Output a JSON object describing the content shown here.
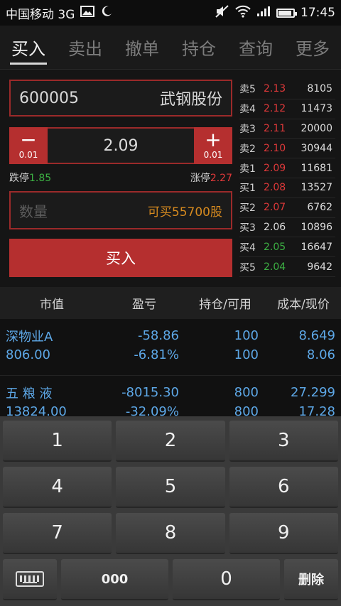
{
  "statusbar": {
    "carrier": "中国移动 3G",
    "time": "17:45",
    "battery_level": 0.9
  },
  "tabs": [
    {
      "label": "买入"
    },
    {
      "label": "卖出"
    },
    {
      "label": "撤单"
    },
    {
      "label": "持仓"
    },
    {
      "label": "查询"
    },
    {
      "label": "更多"
    }
  ],
  "order": {
    "stock_code": "600005",
    "stock_name": "武钢股份",
    "minus_symbol": "−",
    "plus_symbol": "+",
    "step": "0.01",
    "price": "2.09",
    "limit_down_label": "跌停",
    "limit_down": "1.85",
    "limit_up_label": "涨停",
    "limit_up": "2.27",
    "qty_placeholder": "数量",
    "available": "可买55700股",
    "buy_label": "买入"
  },
  "book": [
    {
      "label": "卖5",
      "price": "2.13",
      "volume": "8105",
      "color": "red"
    },
    {
      "label": "卖4",
      "price": "2.12",
      "volume": "11473",
      "color": "red"
    },
    {
      "label": "卖3",
      "price": "2.11",
      "volume": "20000",
      "color": "red"
    },
    {
      "label": "卖2",
      "price": "2.10",
      "volume": "30944",
      "color": "red"
    },
    {
      "label": "卖1",
      "price": "2.09",
      "volume": "11681",
      "color": "red"
    },
    {
      "label": "买1",
      "price": "2.08",
      "volume": "13527",
      "color": "red"
    },
    {
      "label": "买2",
      "price": "2.07",
      "volume": "6762",
      "color": "red"
    },
    {
      "label": "买3",
      "price": "2.06",
      "volume": "10896",
      "color": "white"
    },
    {
      "label": "买4",
      "price": "2.05",
      "volume": "16647",
      "color": "green"
    },
    {
      "label": "买5",
      "price": "2.04",
      "volume": "9642",
      "color": "green"
    }
  ],
  "holdings": {
    "headers": [
      "市值",
      "盈亏",
      "持仓/可用",
      "成本/现价"
    ],
    "rows": [
      {
        "name": "深物业A",
        "value": "806.00",
        "pnl": "-58.86",
        "pnl_pct": "-6.81%",
        "position": "100",
        "available": "100",
        "cost": "8.649",
        "current": "8.06"
      },
      {
        "name": "五 粮 液",
        "value": "13824.00",
        "pnl": "-8015.30",
        "pnl_pct": "-32.09%",
        "position": "800",
        "available": "800",
        "cost": "27.299",
        "current": "17.28"
      }
    ]
  },
  "keypad": {
    "row1": [
      "1",
      "2",
      "3"
    ],
    "row2": [
      "4",
      "5",
      "6"
    ],
    "row3": [
      "7",
      "8",
      "9"
    ],
    "k000": "000",
    "k0": "0",
    "delete": "删除"
  }
}
